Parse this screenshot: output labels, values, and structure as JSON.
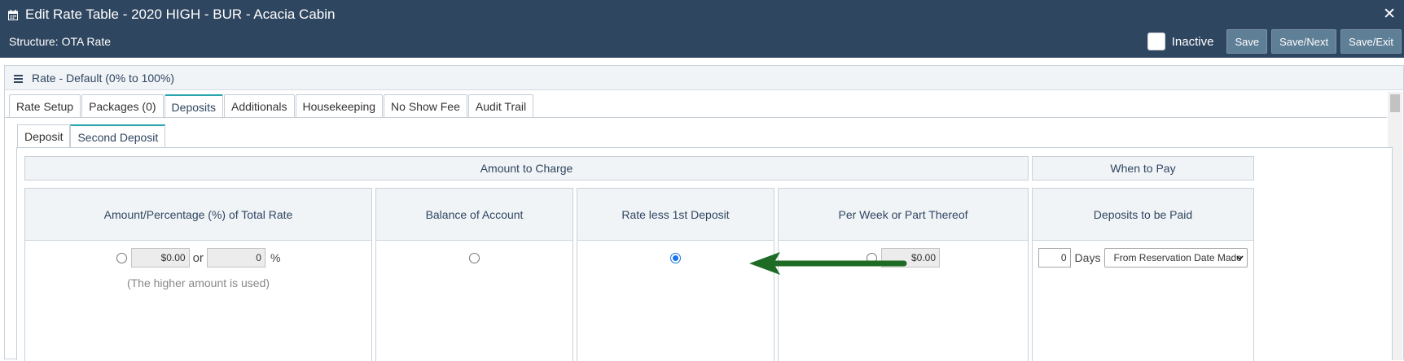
{
  "window": {
    "title": "Edit Rate Table - 2020 HIGH - BUR - Acacia Cabin",
    "structure": "Structure: OTA Rate",
    "close_label": "✕"
  },
  "toolbar": {
    "inactive_label": "Inactive",
    "save_label": "Save",
    "save_next_label": "Save/Next",
    "save_exit_label": "Save/Exit"
  },
  "panel": {
    "title": "Rate - Default (0% to 100%)"
  },
  "tabs": [
    {
      "label": "Rate Setup",
      "active": false
    },
    {
      "label": "Packages (0)",
      "active": false
    },
    {
      "label": "Deposits",
      "active": true
    },
    {
      "label": "Additionals",
      "active": false
    },
    {
      "label": "Housekeeping",
      "active": false
    },
    {
      "label": "No Show Fee",
      "active": false
    },
    {
      "label": "Audit Trail",
      "active": false
    }
  ],
  "subtabs": [
    {
      "label": "Deposit",
      "active": false
    },
    {
      "label": "Second Deposit",
      "active": true
    }
  ],
  "groups": {
    "amount_to_charge": "Amount to Charge",
    "when_to_pay": "When to Pay"
  },
  "columns": {
    "amount_percentage": {
      "header": "Amount/Percentage (%) of Total Rate",
      "amount_value": "$0.00",
      "or_label": "or",
      "percent_value": "0",
      "percent_sign": "%",
      "note": "(The higher amount is used)",
      "selected": false
    },
    "balance_of_account": {
      "header": "Balance of Account",
      "selected": false
    },
    "rate_less_first_deposit": {
      "header": "Rate less 1st Deposit",
      "selected": true
    },
    "per_week": {
      "header": "Per Week or Part Thereof",
      "amount_value": "$0.00",
      "selected": false
    },
    "deposits_to_be_paid": {
      "header": "Deposits to be Paid",
      "days_value": "0",
      "days_label": "Days",
      "select_value": "From Reservation Date Made"
    }
  },
  "colors": {
    "titlebar": "#2f4660",
    "accent_tab": "#2aa4ad",
    "button": "#5f7f96",
    "arrow": "#1e6b26"
  }
}
